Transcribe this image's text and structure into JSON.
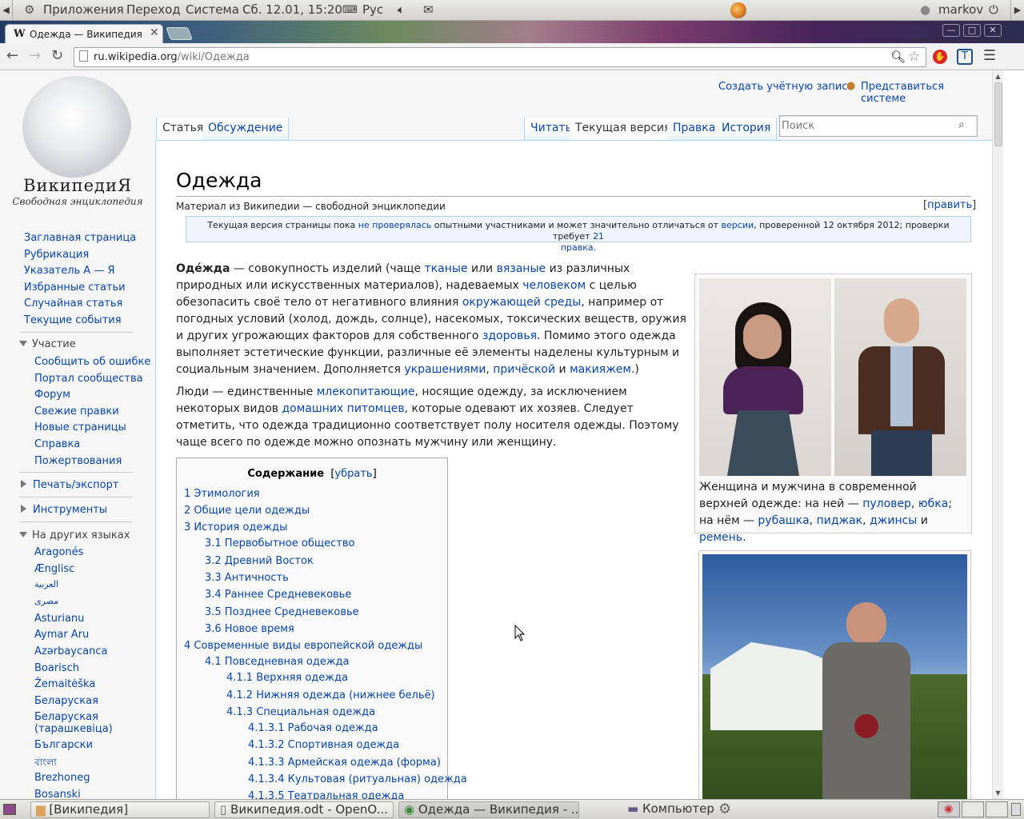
{
  "panel": {
    "apps": "Приложения",
    "places": "Переход",
    "system": "Система",
    "clock": "Сб. 12.01, 15:20",
    "layout": "Рус",
    "user": "markov"
  },
  "browser": {
    "tab_title": "Одежда — Википедия",
    "url_host": "ru.wikipedia.org",
    "url_path": "/wiki/Одежда"
  },
  "wiki": {
    "logo_name": "ВикипедиЯ",
    "logo_tagline": "Свободная энциклопедия",
    "personal": {
      "create": "Создать учётную запись",
      "login": "Представиться системе"
    },
    "tabs": {
      "article": "Статья",
      "talk": "Обсуждение",
      "read": "Читать",
      "current": "Текущая версия",
      "edit": "Правка",
      "history": "История"
    },
    "search": {
      "placeholder": "Поиск"
    },
    "nav": [
      "Заглавная страница",
      "Рубрикация",
      "Указатель А — Я",
      "Избранные статьи",
      "Случайная статья",
      "Текущие события"
    ],
    "participation": {
      "heading": "Участие",
      "items": [
        "Сообщить об ошибке",
        "Портал сообщества",
        "Форум",
        "Свежие правки",
        "Новые страницы",
        "Справка",
        "Пожертвования"
      ]
    },
    "print": "Печать/экспорт",
    "tools": "Инструменты",
    "langs": {
      "heading": "На других языках",
      "items": [
        "Aragonés",
        "Ænglisc",
        "العربية",
        "مصرى",
        "Asturianu",
        "Aymar Aru",
        "Azərbaycanca",
        "Boarisch",
        "Žemaitėška",
        "Беларуская",
        "Беларуская (тарашкевіца)",
        "Български",
        "Brezhoneg",
        "Bosanski"
      ]
    },
    "title": "Одежда",
    "subtitle": "Материал из Википедии — свободной энциклопедии",
    "edit_link": "править",
    "notice": {
      "t1": "Текущая версия страницы пока ",
      "l1": "не проверялась",
      "t2": " опытными участниками и может значительно отличаться от ",
      "l2": "версии",
      "t3": ", проверенной 12 октября 2012; проверки требует ",
      "l3a": "21",
      "l3b": "правка",
      "t4": "."
    },
    "p1": {
      "b": "Оде́жда",
      "t1": " — совокупность изделий (чаще ",
      "l1": "тканые",
      "t2": " или ",
      "l2": "вязаные",
      "t3": " из различных природных или искусственных материалов), надеваемых ",
      "l3": "человеком",
      "t4": " с целью обезопасить своё тело от негативного влияния ",
      "l4": "окружающей среды",
      "t5": ", например от погодных условий (холод, дождь, солнце), насекомых, токсических веществ, оружия и других угрожающих факторов для собственного ",
      "l5": "здоровья",
      "t6": ". Помимо этого одежда выполняет эстетические функции, различные её элементы наделены культурным и социальным значением. Дополняется ",
      "l6": "украшениями",
      "t7": ", ",
      "l7": "причёской",
      "t8": " и ",
      "l8": "макияжем",
      "t9": ".)"
    },
    "p2": {
      "t1": "Люди — единственные ",
      "l1": "млекопитающие",
      "t2": ", носящие одежду, за исключением некоторых видов ",
      "l2": "домашних питомцев",
      "t3": ", которые одевают их хозяев. Следует отметить, что одежда традиционно соответствует полу носителя одежды. Поэтому чаще всего по одежде можно опознать мужчину или женщину."
    },
    "toc": {
      "title": "Содержание",
      "hide": "убрать",
      "items": [
        "1 Этимология",
        "2 Общие цели одежды",
        "3 История одежды",
        "3.1 Первобытное общество",
        "3.2 Древний Восток",
        "3.3 Античность",
        "3.4 Раннее Средневековье",
        "3.5 Позднее Средневековье",
        "3.6 Новое время",
        "4 Современные виды европейской одежды",
        "4.1 Повседневная одежда",
        "4.1.1 Верхняя одежда",
        "4.1.2 Нижняя одежда (нижнее бельё)",
        "4.1.3 Специальная одежда",
        "4.1.3.1 Рабочая одежда",
        "4.1.3.2 Спортивная одежда",
        "4.1.3.3 Армейская одежда (форма)",
        "4.1.3.4 Культовая (ритуальная) одежда",
        "4.1.3.5 Театральная одежда"
      ]
    },
    "caption": {
      "t1": "Женщина и мужчина в современной верхней одежде: на ней — ",
      "l1": "пуловер",
      "t2": ", ",
      "l2": "юбка",
      "t3": "; на нём — ",
      "l3": "рубашка",
      "t4": ", ",
      "l4": "пиджак",
      "t5": ", ",
      "l5": "джинсы",
      "t6": " и ",
      "l6": "ремень",
      "t7": "."
    }
  },
  "taskbar": [
    "[Википедия]",
    "Википедия.odt - OpenO...",
    "Одежда — Википедия - ...",
    "Компьютер"
  ]
}
